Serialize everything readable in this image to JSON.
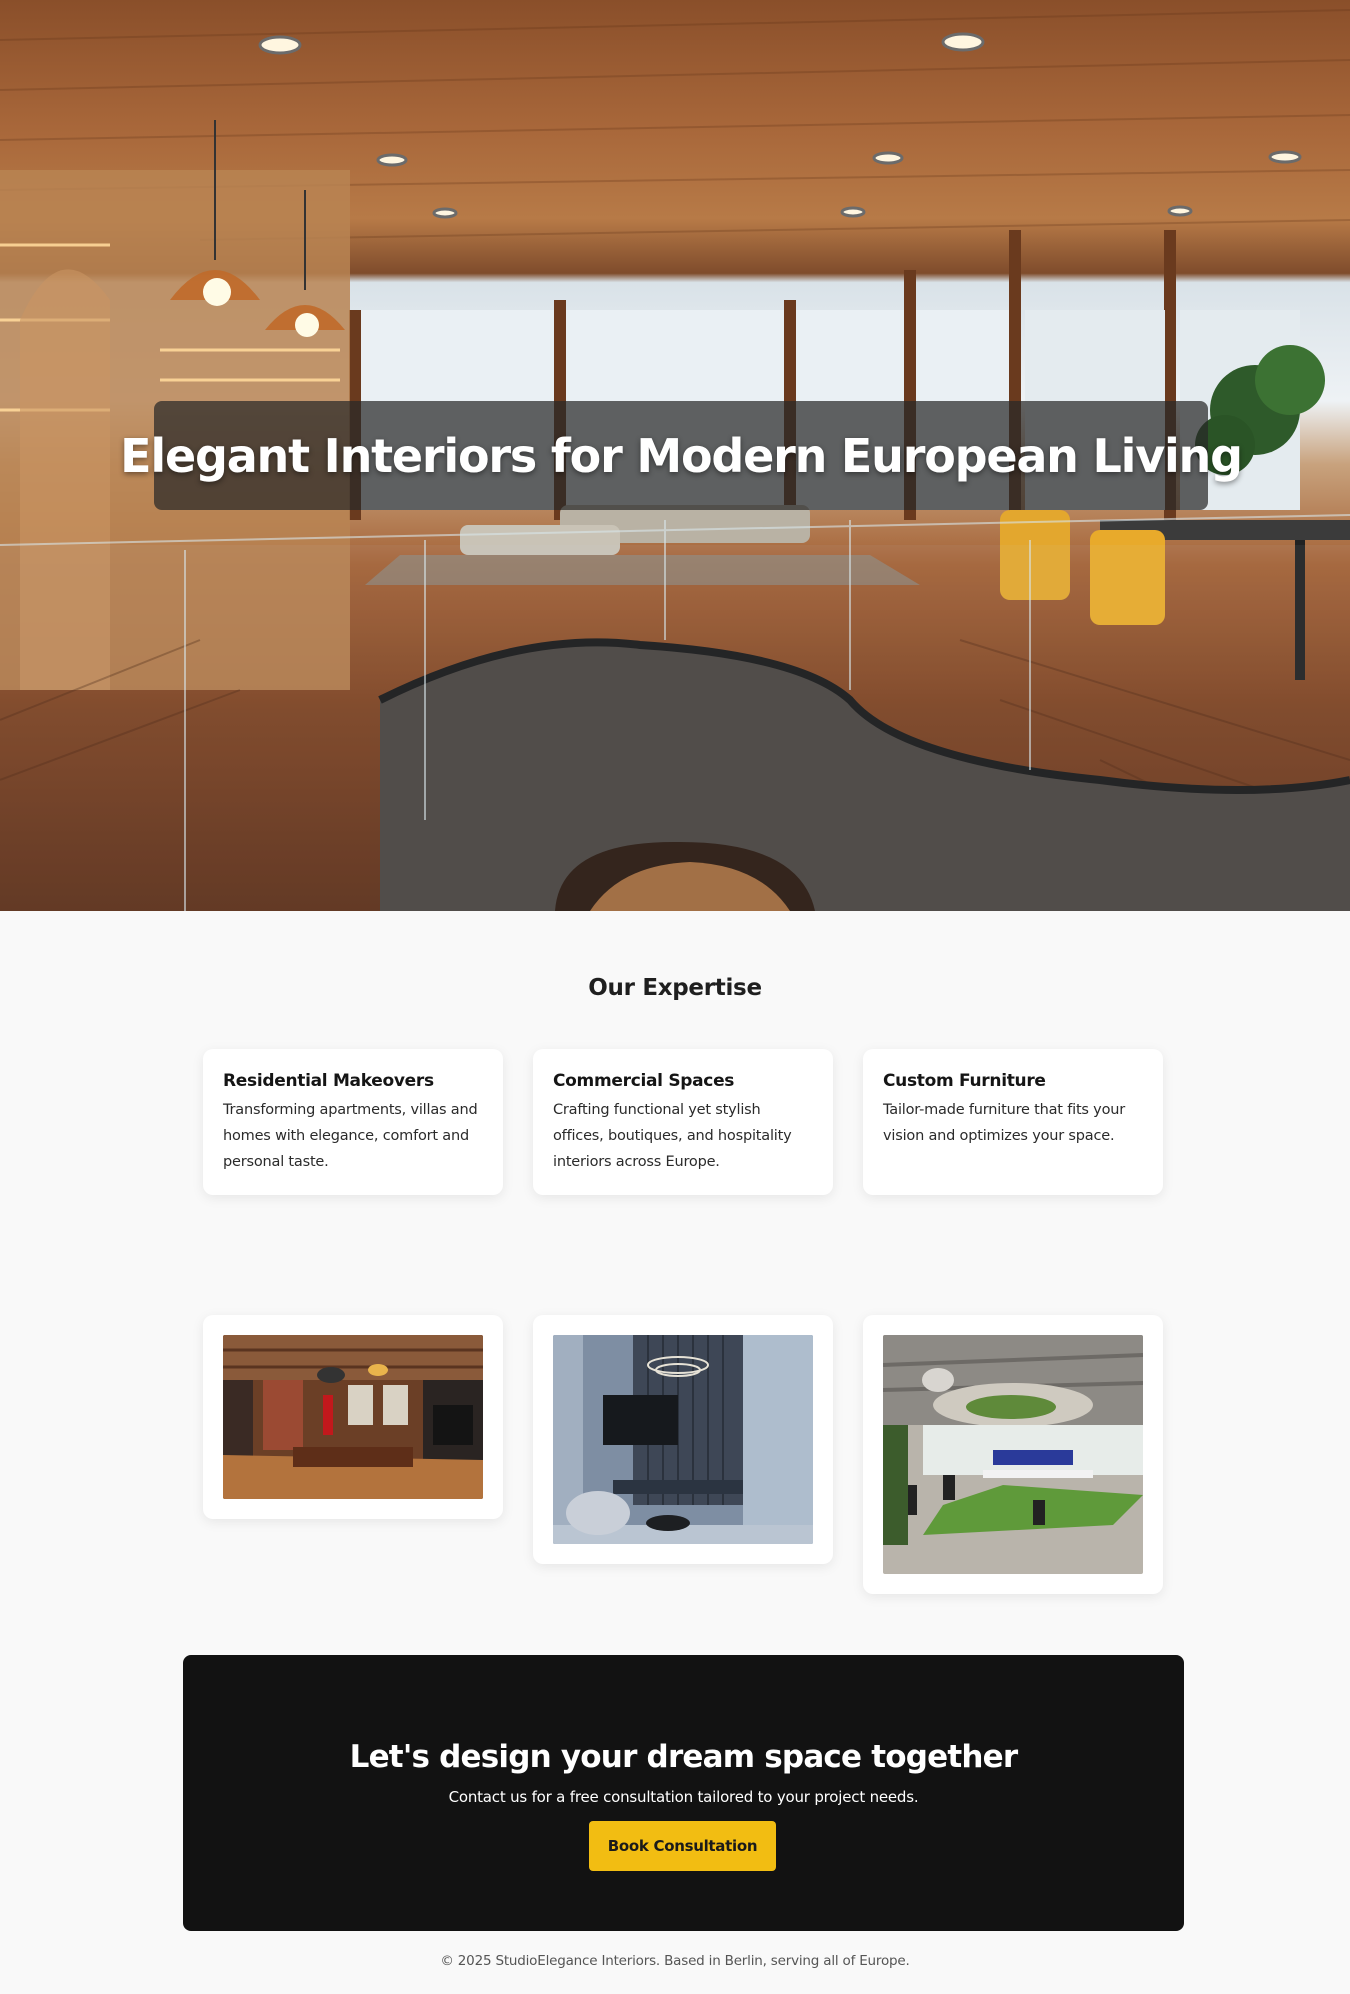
{
  "hero": {
    "title": "Elegant Interiors for Modern European Living"
  },
  "expertise": {
    "title": "Our Expertise",
    "cards": [
      {
        "title": "Residential Makeovers",
        "text": "Transforming apartments, villas and homes with elegance, comfort and personal taste."
      },
      {
        "title": "Commercial Spaces",
        "text": "Crafting functional yet stylish offices, boutiques, and hospitality interiors across Europe."
      },
      {
        "title": "Custom Furniture",
        "text": "Tailor-made furniture that fits your vision and optimizes your space."
      }
    ]
  },
  "cta": {
    "title": "Let's design your dream space together",
    "subtitle": "Contact us for a free consultation tailored to your project needs.",
    "button": "Book Consultation"
  },
  "footer": {
    "text": "© 2025 StudioElegance Interiors. Based in Berlin, serving all of Europe."
  },
  "colors": {
    "accent": "#f2bd12",
    "cta_bg": "#121212",
    "page_bg": "#f9f9f9"
  }
}
